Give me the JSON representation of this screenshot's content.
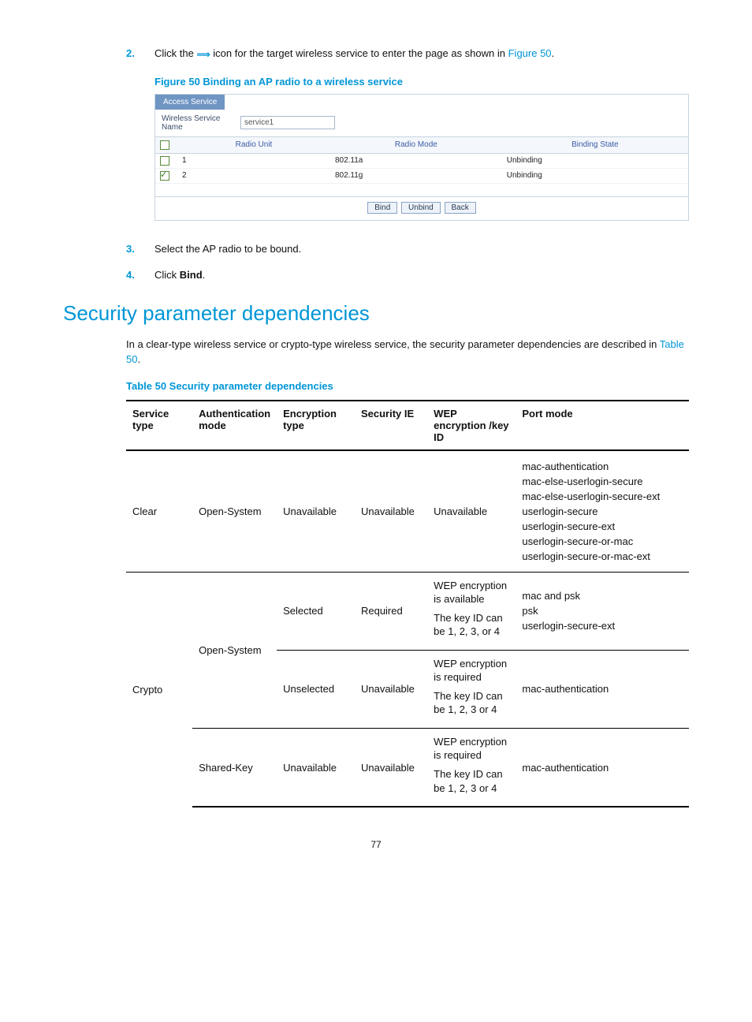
{
  "steps": {
    "s2": {
      "num": "2.",
      "pre": "Click the ",
      "mid": " icon for the target wireless service to enter the page as shown in ",
      "figref": "Figure 50",
      "post": "."
    },
    "s3": {
      "num": "3.",
      "text": "Select the AP radio to be bound."
    },
    "s4": {
      "num": "4.",
      "pre": "Click ",
      "bold": "Bind",
      "post": "."
    }
  },
  "figure": {
    "caption": "Figure 50 Binding an AP radio to a wireless service",
    "tab": "Access Service",
    "name_label": "Wireless Service Name",
    "name_value": "service1",
    "cols": {
      "radio": "Radio Unit",
      "mode": "Radio Mode",
      "state": "Binding State"
    },
    "rows": [
      {
        "checked": false,
        "unit": "1",
        "mode": "802.11a",
        "state": "Unbinding"
      },
      {
        "checked": true,
        "unit": "2",
        "mode": "802.11g",
        "state": "Unbinding"
      }
    ],
    "btn_bind": "Bind",
    "btn_unbind": "Unbind",
    "btn_back": "Back"
  },
  "heading": "Security parameter dependencies",
  "para": {
    "pre": "In a clear-type wireless service or crypto-type wireless service, the security parameter dependencies are described in ",
    "ref": "Table 50",
    "post": "."
  },
  "table_caption": "Table 50 Security parameter dependencies",
  "headers": {
    "service": "Service type",
    "auth": "Authentication mode",
    "enc": "Encryption type",
    "secie": "Security IE",
    "wep": "WEP encryption /key ID",
    "port": "Port mode"
  },
  "rows": {
    "r1": {
      "service": "Clear",
      "auth": "Open-System",
      "enc": "Unavailable",
      "secie": "Unavailable",
      "wep": "Unavailable",
      "port": [
        "mac-authentication",
        "mac-else-userlogin-secure",
        "mac-else-userlogin-secure-ext",
        "userlogin-secure",
        "userlogin-secure-ext",
        "userlogin-secure-or-mac",
        "userlogin-secure-or-mac-ext"
      ]
    },
    "r2": {
      "service": "Crypto",
      "auth": "Open-System",
      "enc": "Selected",
      "secie": "Required",
      "wep1": "WEP encryption is available",
      "wep2": "The key ID can be 1, 2, 3, or 4",
      "port": [
        "mac and psk",
        "psk",
        "userlogin-secure-ext"
      ]
    },
    "r3": {
      "enc": "Unselected",
      "secie": "Unavailable",
      "wep1": "WEP encryption is required",
      "wep2": "The key ID can be 1, 2, 3 or 4",
      "port": "mac-authentication"
    },
    "r4": {
      "auth": "Shared-Key",
      "enc": "Unavailable",
      "secie": "Unavailable",
      "wep1": "WEP encryption is required",
      "wep2": "The key ID can be 1, 2, 3 or 4",
      "port": "mac-authentication"
    }
  },
  "page_number": "77"
}
